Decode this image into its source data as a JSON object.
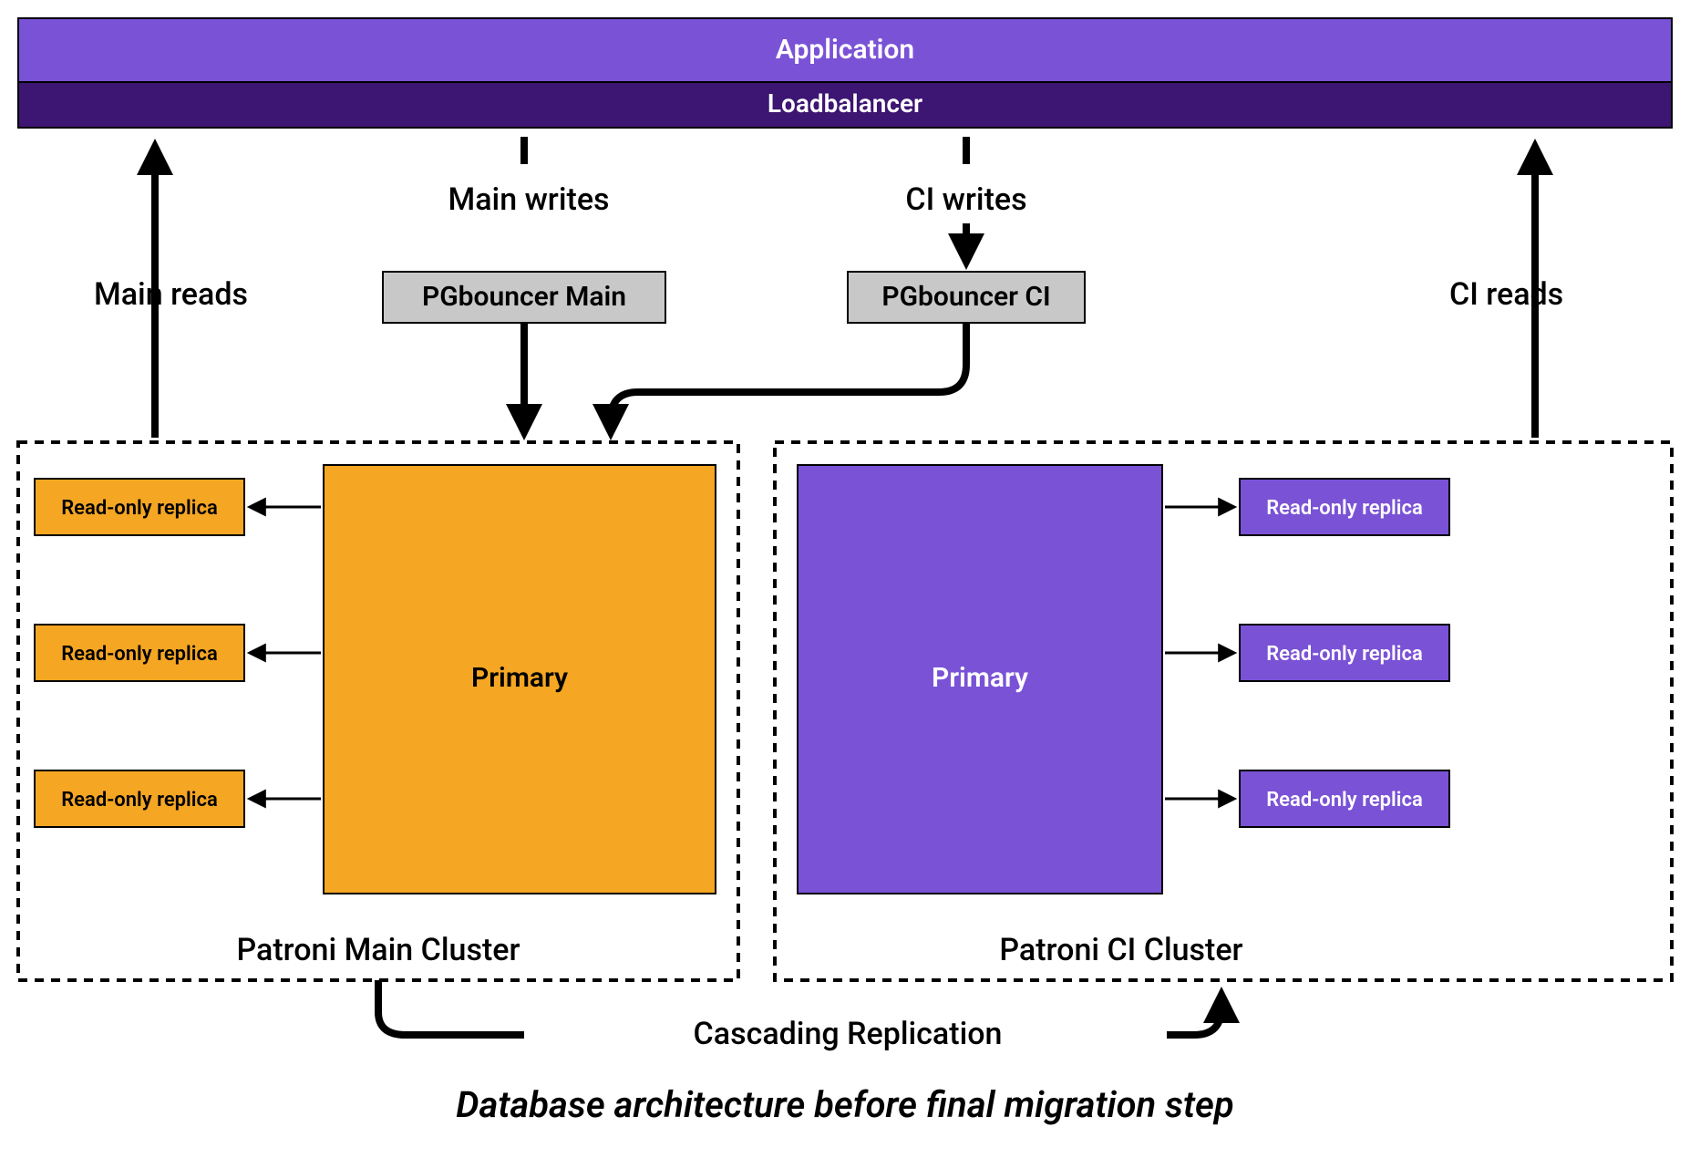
{
  "colors": {
    "purple_light": "#7a52d6",
    "purple_dark": "#3d1572",
    "orange": "#f5a623",
    "grey": "#c8c8c8",
    "black": "#000000",
    "white": "#ffffff"
  },
  "top": {
    "application": "Application",
    "loadbalancer": "Loadbalancer"
  },
  "flows": {
    "main_writes": "Main writes",
    "ci_writes": "CI writes",
    "main_reads": "Main reads",
    "ci_reads": "CI reads",
    "cascading": "Cascading Replication"
  },
  "pgbouncer": {
    "main": "PGbouncer Main",
    "ci": "PGbouncer CI"
  },
  "clusters": {
    "main": {
      "title": "Patroni Main Cluster",
      "primary": "Primary",
      "replica": "Read-only replica"
    },
    "ci": {
      "title": "Patroni CI Cluster",
      "primary": "Primary",
      "replica": "Read-only replica"
    }
  },
  "caption": "Database architecture before final migration step"
}
